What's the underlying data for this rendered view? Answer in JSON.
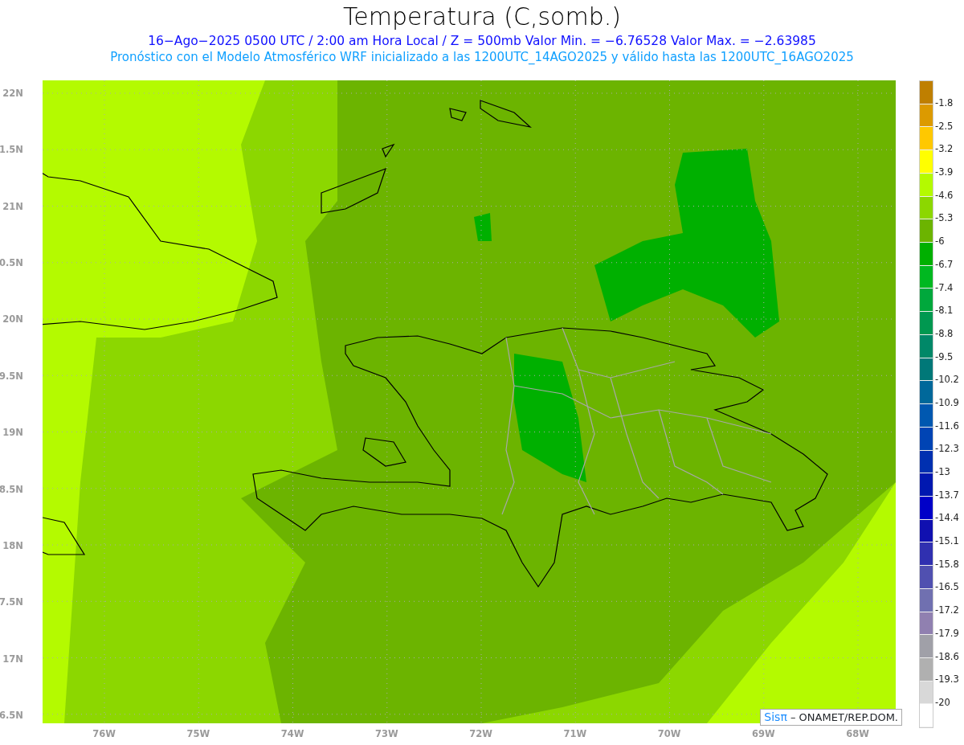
{
  "title": "Temperatura (C,somb.)",
  "subtitle": "16−Ago−2025  0500 UTC / 2:00 am Hora Local / Z = 500mb  Valor Min. = −6.76528  Valor Max. = −2.63985",
  "forecast_note": "Pronóstico con el Modelo Atmosférico WRF inicializado a las 1200UTC_14AGO2025 y válido hasta las  1200UTC_16AGO2025",
  "map": {
    "lat_labels": [
      "22N",
      "1.5N",
      "21N",
      "0.5N",
      "20N",
      "9.5N",
      "19N",
      "8.5N",
      "18N",
      "7.5N",
      "17N",
      "6.5N"
    ],
    "lon_labels": [
      "76W",
      "75W",
      "74W",
      "73W",
      "72W",
      "71W",
      "70W",
      "69W",
      "68W"
    ]
  },
  "legend": {
    "boxes": [
      {
        "color": "#bf7f00"
      },
      {
        "color": "#dc9a00"
      },
      {
        "color": "#ffc800"
      },
      {
        "color": "#ffff00"
      },
      {
        "color": "#b4fa00"
      },
      {
        "color": "#8cd700"
      },
      {
        "color": "#6cb400"
      },
      {
        "color": "#00b000"
      },
      {
        "color": "#00b820"
      },
      {
        "color": "#00a83c"
      },
      {
        "color": "#009850"
      },
      {
        "color": "#008868"
      },
      {
        "color": "#007878"
      },
      {
        "color": "#00689a"
      },
      {
        "color": "#0058b0"
      },
      {
        "color": "#0044b4"
      },
      {
        "color": "#0030b0"
      },
      {
        "color": "#0018b0"
      },
      {
        "color": "#0000c8"
      },
      {
        "color": "#1010b0"
      },
      {
        "color": "#3030b0"
      },
      {
        "color": "#5050b0"
      },
      {
        "color": "#7070b0"
      },
      {
        "color": "#9080b0"
      },
      {
        "color": "#a0a0a8"
      },
      {
        "color": "#b0b0b0"
      },
      {
        "color": "#d8d8d8"
      },
      {
        "color": "#ffffff"
      }
    ],
    "labels": [
      "-1.8",
      "-2.5",
      "-3.2",
      "-3.9",
      "-4.6",
      "-5.3",
      "-6",
      "-6.7",
      "-7.4",
      "-8.1",
      "-8.8",
      "-9.5",
      "-10.2",
      "-10.9",
      "-11.6",
      "-12.3",
      "-13",
      "-13.7",
      "-14.4",
      "-15.1",
      "-15.8",
      "-16.5",
      "-17.2",
      "-17.9",
      "-18.6",
      "-19.3",
      "-20"
    ]
  },
  "credit": {
    "brand": "Sisπ",
    "text": "– ONAMET/REP.DOM."
  }
}
